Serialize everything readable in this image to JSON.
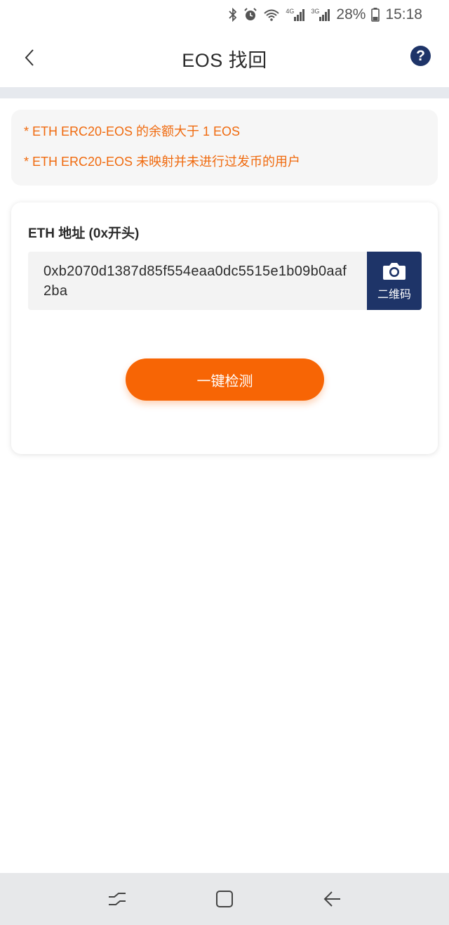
{
  "status_bar": {
    "battery": "28%",
    "time": "15:18",
    "network_4g": "4G",
    "network_3g": "3G"
  },
  "header": {
    "title": "EOS 找回"
  },
  "notice": {
    "lines": [
      "* ETH ERC20-EOS 的余额大于 1 EOS",
      "* ETH ERC20-EOS 未映射并未进行过发币的用户"
    ],
    "color": "#f06a0e"
  },
  "form": {
    "address_label": "ETH 地址 (0x开头)",
    "address_value": "0xb2070d1387d85f554eaa0dc5515e1b09b0aaf2ba",
    "qr_button_label": "二维码",
    "detect_button_label": "一键检测"
  },
  "colors": {
    "accent": "#f76505",
    "brand_navy": "#1e3468"
  }
}
